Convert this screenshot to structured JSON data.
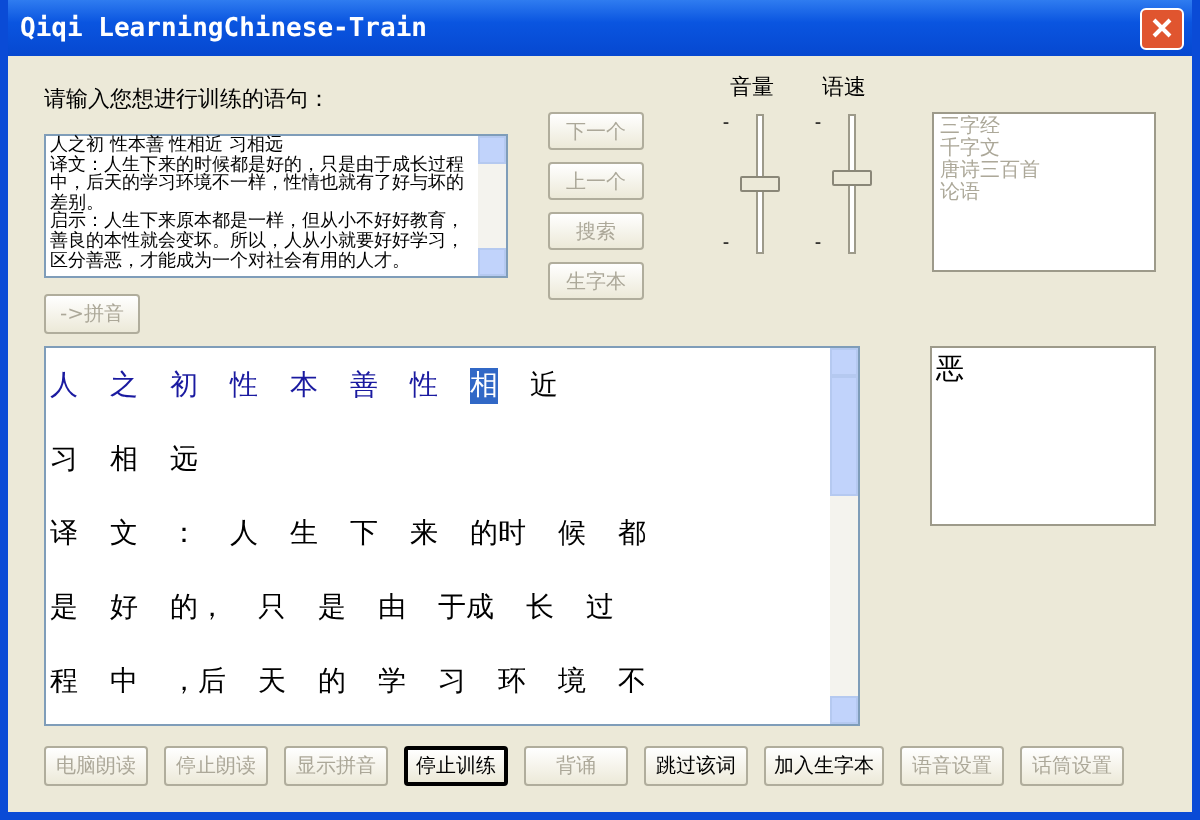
{
  "window": {
    "title": "Qiqi LearningChinese-Train"
  },
  "prompt": "请输入您想进行训练的语句：",
  "input_text": [
    "人之初 性本善 性相近 习相远",
    "译文：人生下来的时候都是好的，只是由于成长过程中，后天的学习环境不一样，性情也就有了好与坏的差别。",
    "启示：人生下来原本都是一样，但从小不好好教育，善良的本性就会变坏。所以，人从小就要好好学习，区分善恶，才能成为一个对社会有用的人才。"
  ],
  "side_buttons": [
    {
      "label": "下一个",
      "disabled": true
    },
    {
      "label": "上一个",
      "disabled": true
    },
    {
      "label": "搜索",
      "disabled": true
    },
    {
      "label": "生字本",
      "disabled": true
    }
  ],
  "pinyin_button": {
    "label": "->拼音",
    "disabled": true
  },
  "sliders": [
    {
      "label": "音量",
      "top_mark": "-",
      "bottom_mark": "-",
      "level": 0.5
    },
    {
      "label": "语速",
      "top_mark": "-",
      "bottom_mark": "-",
      "level": 0.55
    }
  ],
  "texts_list": {
    "disabled": true,
    "items": [
      "三字经",
      "千字文",
      "唐诗三百首",
      "论语"
    ]
  },
  "reading_lines": [
    [
      {
        "text": "人",
        "read": true,
        "current": false
      },
      {
        "text": "之",
        "read": true,
        "current": false
      },
      {
        "text": "初",
        "read": true,
        "current": false
      },
      {
        "text": "性",
        "read": true,
        "current": false
      },
      {
        "text": "本",
        "read": true,
        "current": false
      },
      {
        "text": "善",
        "read": true,
        "current": false
      },
      {
        "text": "性",
        "read": true,
        "current": false
      },
      {
        "text": "相",
        "read": false,
        "current": true
      },
      {
        "text": "近",
        "read": false,
        "current": false
      }
    ],
    [
      {
        "text": "习",
        "read": false,
        "current": false
      },
      {
        "text": "相",
        "read": false,
        "current": false
      },
      {
        "text": "远",
        "read": false,
        "current": false
      }
    ],
    [
      {
        "text": "译",
        "read": false,
        "current": false
      },
      {
        "text": "文",
        "read": false,
        "current": false
      },
      {
        "text": "：",
        "read": false,
        "current": false
      },
      {
        "text": "人",
        "read": false,
        "current": false
      },
      {
        "text": "生",
        "read": false,
        "current": false
      },
      {
        "text": "下",
        "read": false,
        "current": false
      },
      {
        "text": "来",
        "read": false,
        "current": false
      },
      {
        "text": "的时",
        "read": false,
        "current": false
      },
      {
        "text": "候",
        "read": false,
        "current": false
      },
      {
        "text": "都",
        "read": false,
        "current": false
      }
    ],
    [
      {
        "text": "是",
        "read": false,
        "current": false
      },
      {
        "text": "好",
        "read": false,
        "current": false
      },
      {
        "text": "的，",
        "read": false,
        "current": false
      },
      {
        "text": "只",
        "read": false,
        "current": false
      },
      {
        "text": "是",
        "read": false,
        "current": false
      },
      {
        "text": "由",
        "read": false,
        "current": false
      },
      {
        "text": "于成",
        "read": false,
        "current": false
      },
      {
        "text": "长",
        "read": false,
        "current": false
      },
      {
        "text": "过",
        "read": false,
        "current": false
      }
    ],
    [
      {
        "text": "程",
        "read": false,
        "current": false
      },
      {
        "text": "中",
        "read": false,
        "current": false
      },
      {
        "text": "，后",
        "read": false,
        "current": false
      },
      {
        "text": "天",
        "read": false,
        "current": false
      },
      {
        "text": "的",
        "read": false,
        "current": false
      },
      {
        "text": "学",
        "read": false,
        "current": false
      },
      {
        "text": "习",
        "read": false,
        "current": false
      },
      {
        "text": "环",
        "read": false,
        "current": false
      },
      {
        "text": "境",
        "read": false,
        "current": false
      },
      {
        "text": "不",
        "read": false,
        "current": false
      }
    ]
  ],
  "current_word": "恶",
  "bottom_buttons": [
    {
      "label": "电脑朗读",
      "disabled": true
    },
    {
      "label": "停止朗读",
      "disabled": true
    },
    {
      "label": "显示拼音",
      "disabled": true
    },
    {
      "label": "停止训练",
      "disabled": false,
      "default": true
    },
    {
      "label": "背诵",
      "disabled": true
    },
    {
      "label": "跳过该词",
      "disabled": false,
      "default": false
    },
    {
      "label": "加入生字本",
      "disabled": false,
      "default": false
    },
    {
      "label": "语音设置",
      "disabled": true
    },
    {
      "label": "话筒设置",
      "disabled": true
    }
  ]
}
